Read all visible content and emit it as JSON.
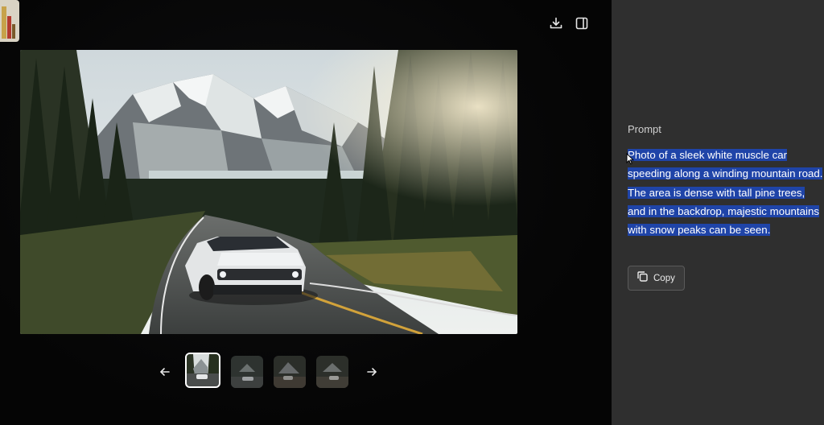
{
  "toolbar": {
    "download_icon": "download-icon",
    "sidebar_toggle_icon": "panel-toggle-icon"
  },
  "carousel": {
    "prev_icon": "arrow-left-icon",
    "next_icon": "arrow-right-icon",
    "thumbnails": [
      {
        "active": true
      },
      {
        "active": false
      },
      {
        "active": false
      },
      {
        "active": false
      }
    ]
  },
  "panel": {
    "label": "Prompt",
    "prompt": "Photo of a sleek white muscle car speeding along a winding mountain road. The area is dense with tall pine trees, and in the backdrop, majestic mountains with snow peaks can be seen.",
    "copy_label": "Copy",
    "copy_icon": "copy-icon"
  },
  "colors": {
    "selection": "#1f44a8",
    "panel_bg": "#2f2f2f",
    "viewer_bg": "#050505"
  }
}
